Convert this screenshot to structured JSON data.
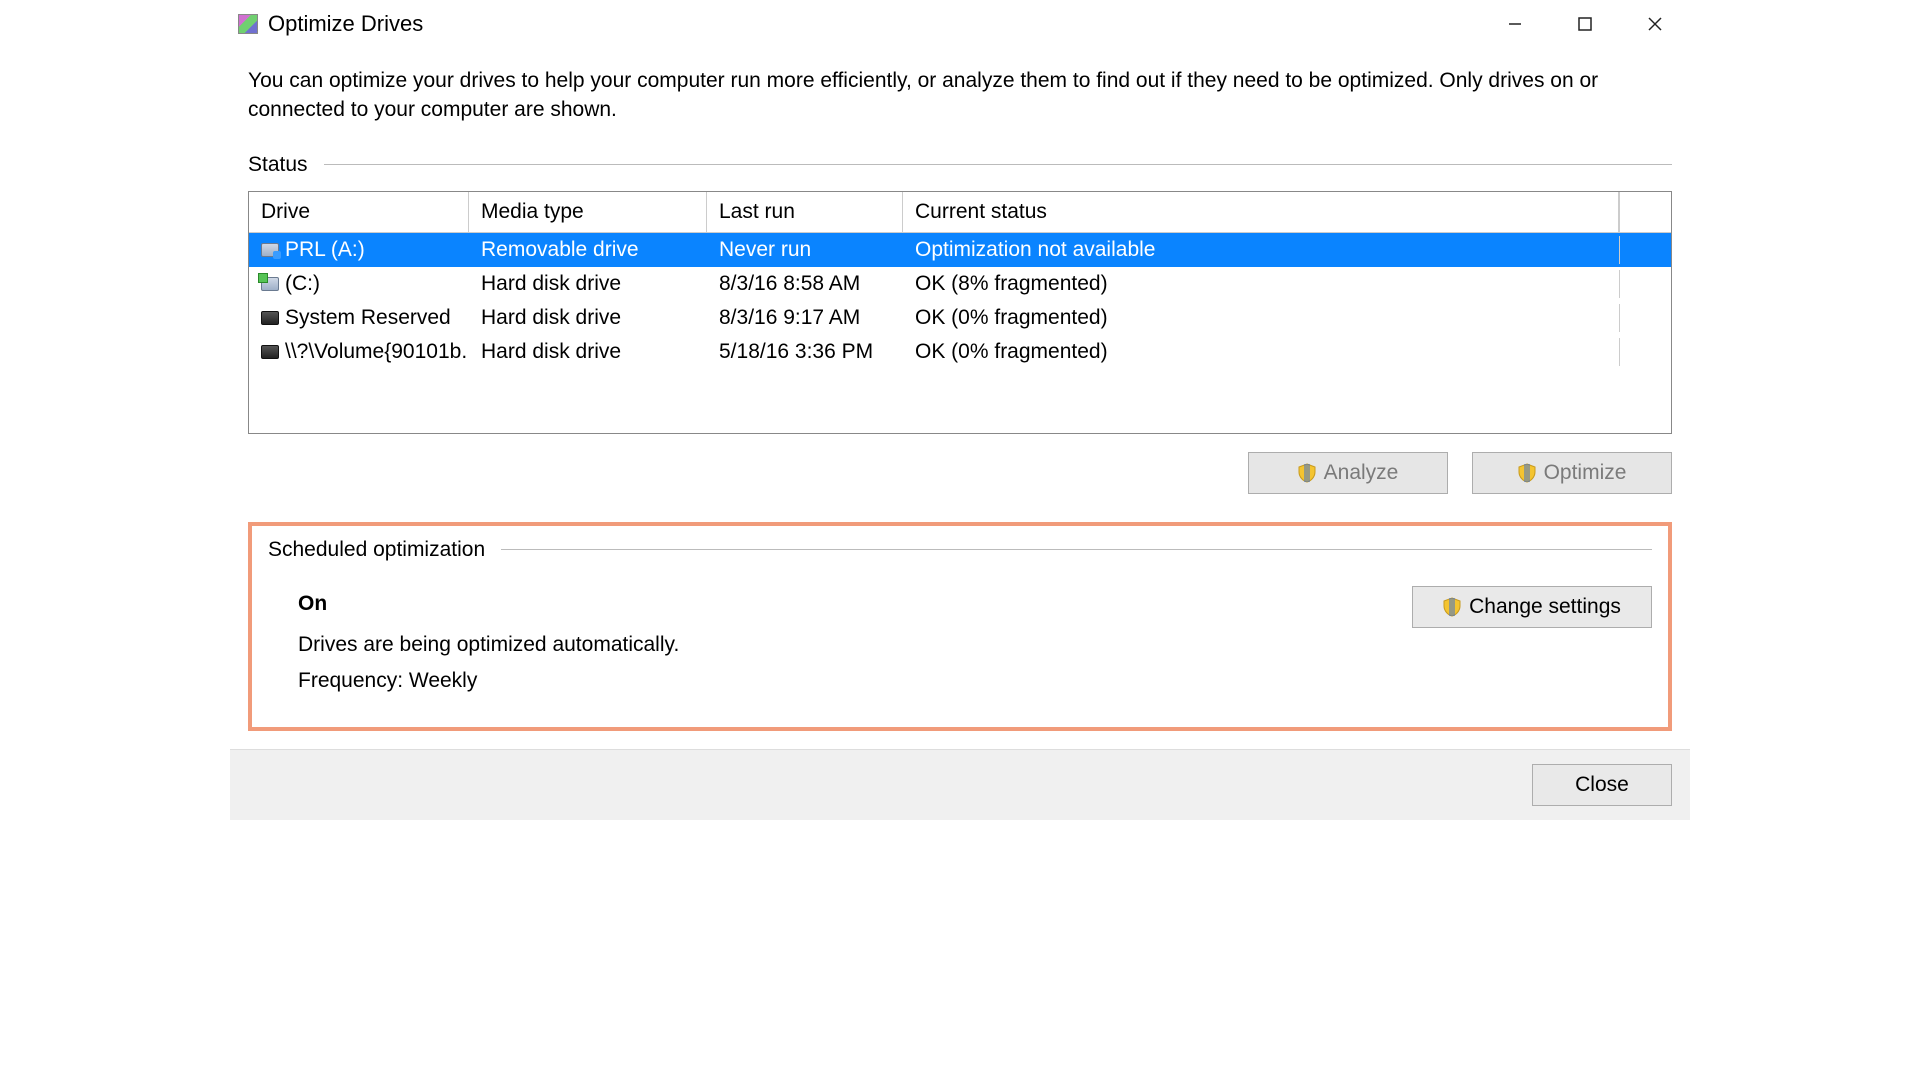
{
  "window": {
    "title": "Optimize Drives"
  },
  "intro": "You can optimize your drives to help your computer run more efficiently, or analyze them to find out if they need to be optimized. Only drives on or connected to your computer are shown.",
  "status_section_label": "Status",
  "table": {
    "headers": {
      "drive": "Drive",
      "media": "Media type",
      "last_run": "Last run",
      "status": "Current status"
    },
    "rows": [
      {
        "name": "PRL (A:)",
        "media": "Removable drive",
        "last_run": "Never run",
        "status": "Optimization not available",
        "icon": "removable",
        "selected": true
      },
      {
        "name": "(C:)",
        "media": "Hard disk drive",
        "last_run": "8/3/16 8:58 AM",
        "status": "OK (8% fragmented)",
        "icon": "local",
        "selected": false
      },
      {
        "name": "System Reserved",
        "media": "Hard disk drive",
        "last_run": "8/3/16 9:17 AM",
        "status": "OK (0% fragmented)",
        "icon": "dark",
        "selected": false
      },
      {
        "name": "\\\\?\\Volume{90101b...",
        "media": "Hard disk drive",
        "last_run": "5/18/16 3:36 PM",
        "status": "OK (0% fragmented)",
        "icon": "dark",
        "selected": false
      }
    ]
  },
  "buttons": {
    "analyze": "Analyze",
    "optimize": "Optimize",
    "change_settings": "Change settings",
    "close": "Close"
  },
  "scheduled": {
    "section_label": "Scheduled optimization",
    "state": "On",
    "desc": "Drives are being optimized automatically.",
    "frequency": "Frequency: Weekly"
  }
}
